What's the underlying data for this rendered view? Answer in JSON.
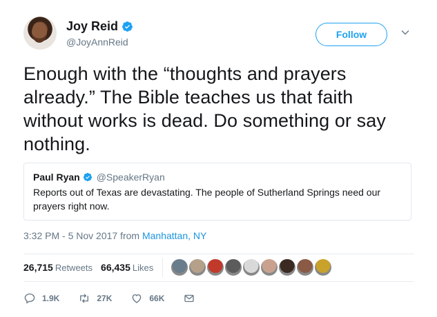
{
  "author": {
    "display_name": "Joy Reid",
    "handle": "@JoyAnnReid",
    "verified": true,
    "avatar_icon": "profile-photo"
  },
  "follow_button": {
    "label": "Follow"
  },
  "tweet": {
    "text": "Enough with the “thoughts and prayers already.” The Bible teaches us that faith without works is dead. Do something or say nothing."
  },
  "quoted_tweet": {
    "display_name": "Paul Ryan",
    "handle": "@SpeakerRyan",
    "verified": true,
    "text": "Reports out of Texas are devastating. The people of Sutherland Springs need our prayers right now."
  },
  "meta": {
    "timestamp": "3:32 PM - 5 Nov 2017 from ",
    "location": "Manhattan, NY"
  },
  "stats": {
    "retweets_count": "26,715",
    "retweets_label": "Retweets",
    "likes_count": "66,435",
    "likes_label": "Likes",
    "liker_avatar_colors": [
      "#6a7d8c",
      "#b5a08a",
      "#c0392b",
      "#5c5c5c",
      "#d9d9d9",
      "#c9a28f",
      "#3b2a22",
      "#8a5a44",
      "#c8a22a"
    ]
  },
  "actions": {
    "reply_count": "1.9K",
    "retweet_count": "27K",
    "like_count": "66K"
  },
  "colors": {
    "accent": "#1da1f2",
    "link": "#1b95e0",
    "muted": "#657786",
    "text": "#14171a"
  }
}
